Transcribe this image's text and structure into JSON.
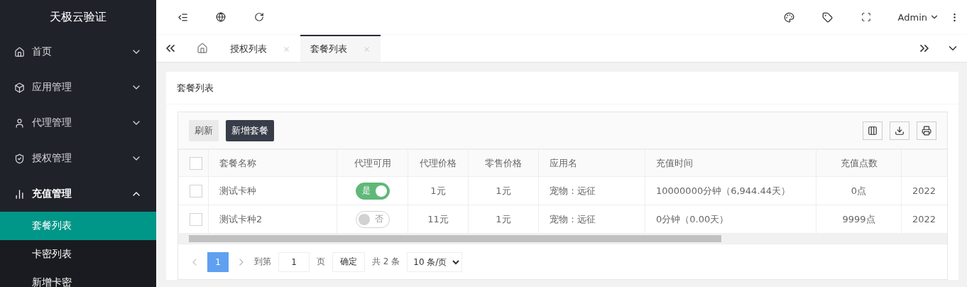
{
  "sidebar": {
    "logo": "天极云验证",
    "items": [
      {
        "label": "首页",
        "expanded": false
      },
      {
        "label": "应用管理",
        "expanded": false
      },
      {
        "label": "代理管理",
        "expanded": false
      },
      {
        "label": "授权管理",
        "expanded": false
      },
      {
        "label": "充值管理",
        "expanded": true,
        "children": [
          {
            "label": "套餐列表",
            "selected": true
          },
          {
            "label": "卡密列表",
            "selected": false
          },
          {
            "label": "新增卡密",
            "selected": false
          }
        ]
      }
    ]
  },
  "header": {
    "user": "Admin"
  },
  "tabs": [
    {
      "label": "授权列表",
      "selected": false
    },
    {
      "label": "套餐列表",
      "selected": true
    }
  ],
  "card": {
    "title": "套餐列表"
  },
  "toolbar": {
    "buttons": [
      {
        "label": "刷新",
        "kind": "plain"
      },
      {
        "label": "新增套餐",
        "kind": "primary"
      }
    ]
  },
  "table": {
    "select_all_checked": false,
    "columns": [
      "套餐名称",
      "代理可用",
      "代理价格",
      "零售价格",
      "应用名",
      "充值时间",
      "充值点数"
    ],
    "rows": [
      {
        "checked": false,
        "name": "测试卡种",
        "agent": {
          "on": true,
          "label": "是"
        },
        "agent_price": "1元",
        "retail_price": "1元",
        "app": "宠物：远征",
        "time": "10000000分钟（6,944.44天）",
        "points": "0点",
        "column_9": "2022"
      },
      {
        "checked": false,
        "name": "测试卡种2",
        "agent": {
          "on": false,
          "label": "否"
        },
        "agent_price": "11元",
        "retail_price": "1元",
        "app": "宠物：远征",
        "time": "0分钟（0.00天）",
        "points": "9999点",
        "column_9": "2022"
      }
    ]
  },
  "pagination": {
    "pages": [
      {
        "label": "1",
        "selected": true
      }
    ],
    "goto_label": "到第",
    "goto_value": "1",
    "page_unit": "页",
    "confirm": "确定",
    "total": "共 2 条",
    "page_size": "10 条/页"
  }
}
